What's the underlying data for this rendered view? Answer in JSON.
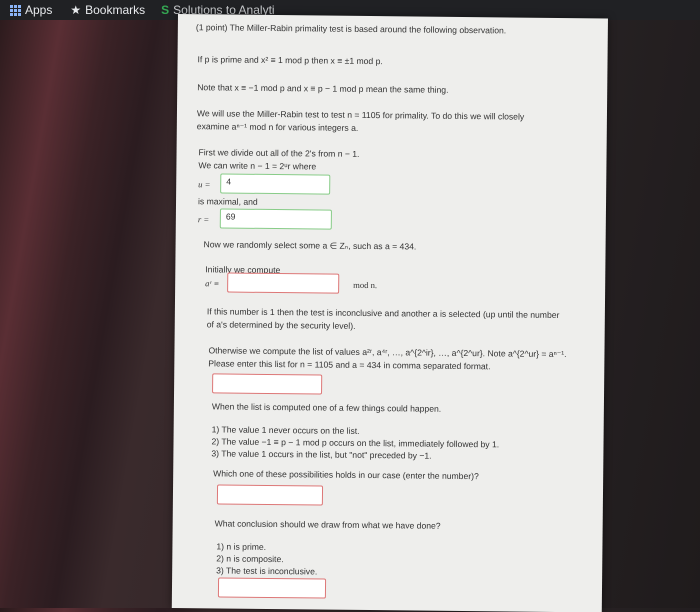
{
  "browser": {
    "apps_label": "Apps",
    "bookmarks_label": "Bookmarks",
    "tab_label": "Solutions to Analyti"
  },
  "problem": {
    "intro": "(1 point) The Miller-Rabin primality test is based around the following observation.",
    "line_if_prime": "If p is prime and x² ≡ 1  mod p then x ≡ ±1  mod p.",
    "line_note": "Note that x ≡ −1  mod p and x ≡ p − 1  mod p mean the same thing.",
    "line_test_1": "We will use the Miller-Rabin test to test n = 1105 for primality. To do this we will closely",
    "line_test_2": "examine aⁿ⁻¹  mod n for various integers a.",
    "divide_1": "First we divide out all of the 2's from n − 1.",
    "divide_2": "We can write n − 1 = 2ᵘr where",
    "u_label": "u =",
    "u_value": "4",
    "maximal": "is maximal, and",
    "r_label": "r =",
    "r_value": "69",
    "select_a": "Now we randomly select some a ∈ Zₙ, such as a = 434.",
    "initially": "Initially we compute",
    "ar_label": "aʳ ≡",
    "ar_value": "",
    "mod_n": "mod n.",
    "if_one_1": "If this number is 1 then the test is inconclusive and another a is selected (up until the number",
    "if_one_2": "of a's determined by the security level).",
    "otherwise_1": "Otherwise we compute the list of values a²ʳ, a⁴ʳ, …, a^{2^ir}, …, a^{2^ur}. Note a^{2^ur} = aⁿ⁻¹.",
    "otherwise_2": "Please enter this list for n = 1105 and a = 434 in comma separated format.",
    "list_value": "",
    "when_computed": "When the list is computed one of a few things could happen.",
    "option_1": "1) The value 1 never occurs on the list.",
    "option_2": "2) The value −1 ≡ p − 1  mod p occurs on the list, immediately followed by 1.",
    "option_3": "3) The value 1 occurs in the list, but \"not\" preceded by −1.",
    "which_one": "Which one of these possibilities holds in our case (enter the number)?",
    "which_value": "",
    "conclusion": "What conclusion should we draw from what we have done?",
    "concl_1": "1) n is prime.",
    "concl_2": "2) n is composite.",
    "concl_3": "3) The test is inconclusive.",
    "conclusion_value": ""
  }
}
